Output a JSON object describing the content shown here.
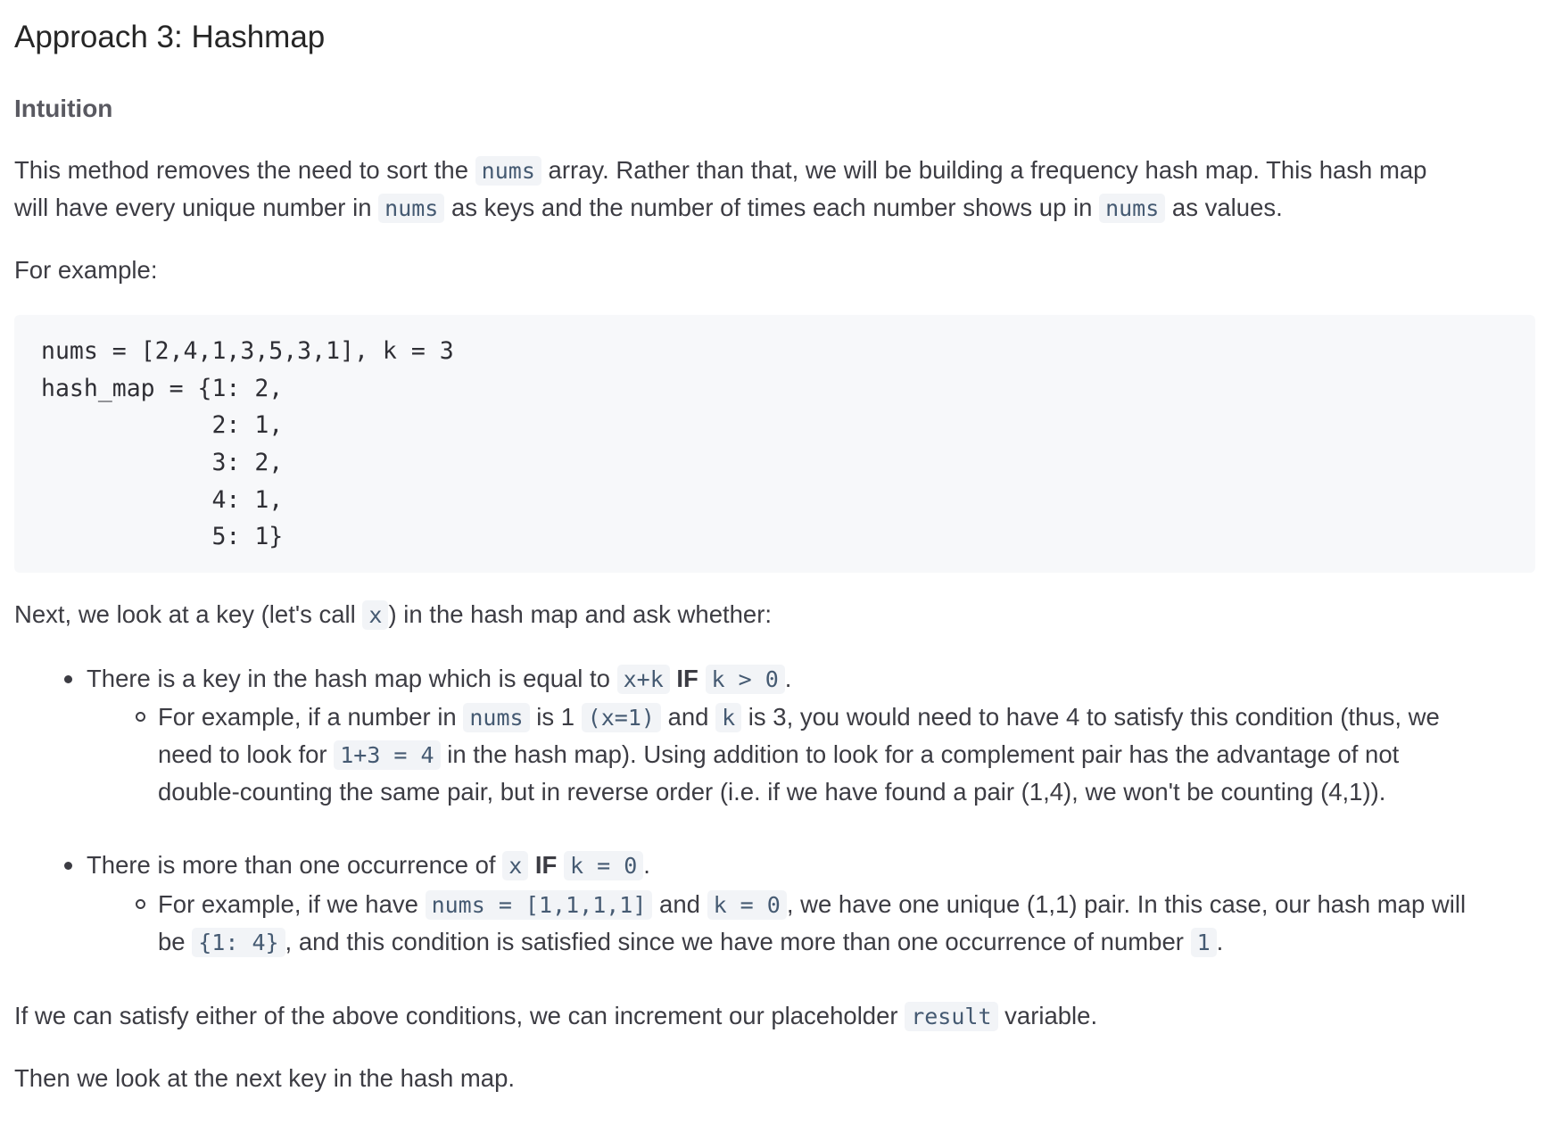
{
  "heading": "Approach 3: Hashmap",
  "subheading": "Intuition",
  "intro": {
    "p1_t1": "This method removes the need to sort the ",
    "p1_c1": "nums",
    "p1_t2": " array. Rather than that, we will be building a frequency hash map. This hash map",
    "p2_t1": "will have every unique number in ",
    "p2_c1": "nums",
    "p2_t2": " as keys and the number of times each number shows up in ",
    "p2_c2": "nums",
    "p2_t3": " as values."
  },
  "example_label": "For example:",
  "code_lines": [
    "nums = [2,4,1,3,5,3,1], k = 3",
    "hash_map = {1: 2,",
    "            2: 1,",
    "            3: 2,",
    "            4: 1,",
    "            5: 1}"
  ],
  "next": {
    "t1": "Next, we look at a key (let's call ",
    "c1": "x",
    "t2": ") in the hash map and ask whether:"
  },
  "bullet1": {
    "t1": "There is a key in the hash map which is equal to ",
    "c1": "x+k",
    "kw": "IF",
    "c2": "k > 0",
    "t2": "."
  },
  "sub1": {
    "l1_t1": "For example, if a number in ",
    "l1_c1": "nums",
    "l1_t2": " is 1 ",
    "l1_c2": "(x=1)",
    "l1_t3": " and ",
    "l1_c3": "k",
    "l1_t4": " is 3, you would need to have 4 to satisfy this condition (thus, we",
    "l2_t1": "need to look for ",
    "l2_c1": "1+3 = 4",
    "l2_t2": " in the hash map). Using addition to look for a complement pair has the advantage of not",
    "l3": "double-counting the same pair, but in reverse order (i.e. if we have found a pair (1,4), we won't be counting (4,1))."
  },
  "bullet2": {
    "t1": "There is more than one occurrence of ",
    "c1": "x",
    "kw": "IF",
    "c2": "k = 0",
    "t2": "."
  },
  "sub2": {
    "l1_t1": "For example, if we have ",
    "l1_c1": "nums = [1,1,1,1]",
    "l1_t2": " and ",
    "l1_c2": "k = 0",
    "l1_t3": ", we have one unique (1,1) pair. In this case, our hash map will",
    "l2_t1": "be ",
    "l2_c1": "{1: 4}",
    "l2_t2": ", and this condition is satisfied since we have more than one occurrence of number ",
    "l2_c2": "1",
    "l2_t3": "."
  },
  "conclusion": {
    "t1": "If we can satisfy either of the above conditions, we can increment our placeholder ",
    "c1": "result",
    "t2": " variable."
  },
  "final": "Then we look at the next key in the hash map."
}
